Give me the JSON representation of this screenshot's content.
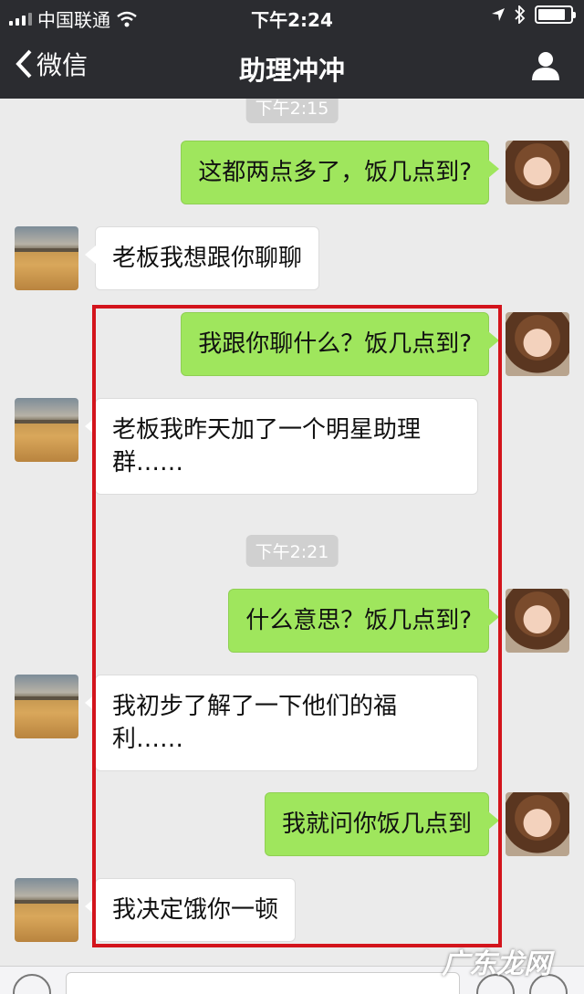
{
  "status_bar": {
    "carrier": "中国联通",
    "time": "下午2:24",
    "battery_level": 0.85
  },
  "nav": {
    "back_label": "微信",
    "title": "助理冲冲"
  },
  "timestamps": [
    "下午2:15",
    "下午2:21"
  ],
  "messages": [
    {
      "from": "me",
      "text": "这都两点多了，饭几点到?"
    },
    {
      "from": "other",
      "text": "老板我想跟你聊聊"
    },
    {
      "from": "me",
      "text": "我跟你聊什么？饭几点到?"
    },
    {
      "from": "other",
      "text": "老板我昨天加了一个明星助理群……"
    },
    {
      "from": "me",
      "text": "什么意思？饭几点到?"
    },
    {
      "from": "other",
      "text": "我初步了解了一下他们的福利……"
    },
    {
      "from": "me",
      "text": "我就问你饭几点到"
    },
    {
      "from": "other",
      "text": "我决定饿你一顿"
    }
  ],
  "watermark": "广东龙网",
  "colors": {
    "nav_background": "#2b2c30",
    "my_bubble": "#9fe65d",
    "other_bubble": "#ffffff",
    "highlight_box": "#d3141c",
    "chat_background": "#ebebeb"
  }
}
